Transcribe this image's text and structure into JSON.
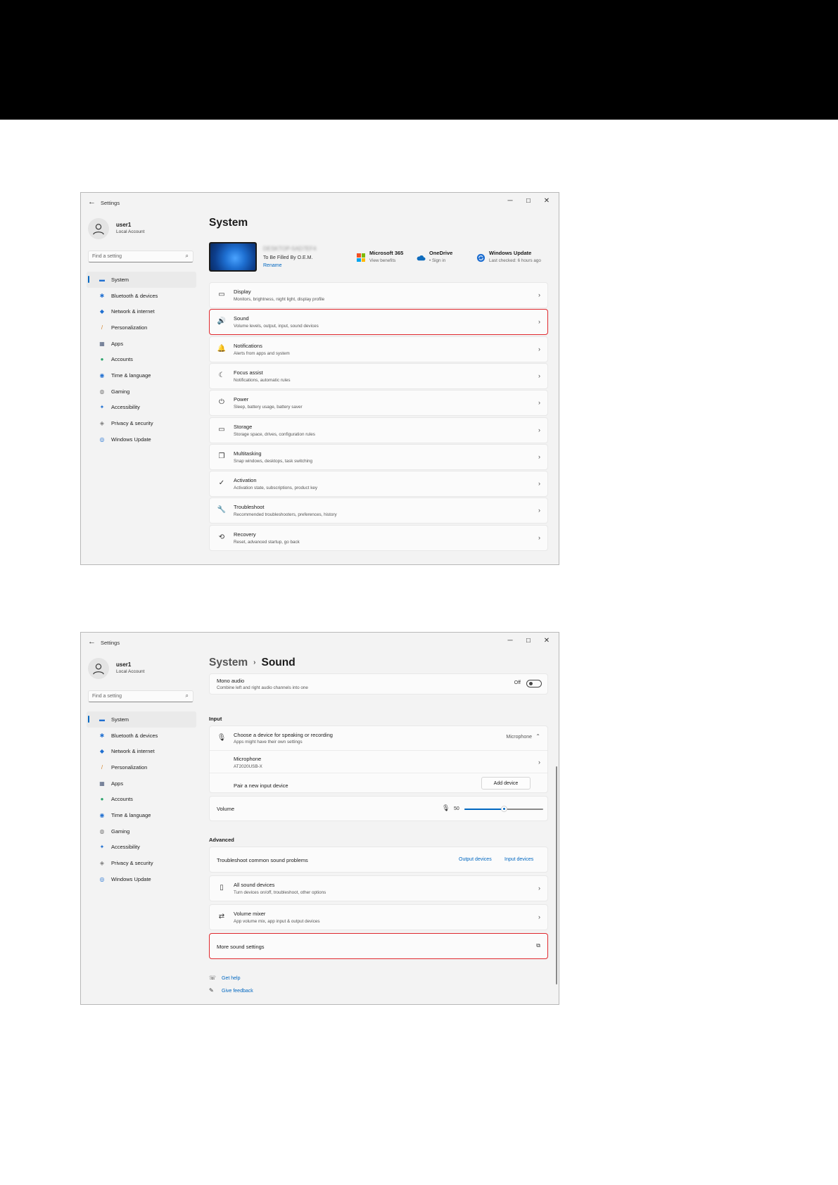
{
  "common": {
    "app_title": "Settings",
    "back_glyph": "←",
    "user_name": "user1",
    "user_type": "Local Account",
    "search_placeholder": "Find a setting",
    "nav": [
      {
        "label": "System",
        "icon": "system-icon",
        "glyph": "▬",
        "color": "#1f6fd1"
      },
      {
        "label": "Bluetooth & devices",
        "icon": "bluetooth-icon",
        "glyph": "✱",
        "color": "#1f6fd1"
      },
      {
        "label": "Network & internet",
        "icon": "network-icon",
        "glyph": "◆",
        "color": "#1f6fd1"
      },
      {
        "label": "Personalization",
        "icon": "brush-icon",
        "glyph": "/",
        "color": "#d4842a"
      },
      {
        "label": "Apps",
        "icon": "apps-icon",
        "glyph": "▦",
        "color": "#4a5a7a"
      },
      {
        "label": "Accounts",
        "icon": "accounts-icon",
        "glyph": "●",
        "color": "#2aa36b"
      },
      {
        "label": "Time & language",
        "icon": "globe-clock-icon",
        "glyph": "◉",
        "color": "#1f6fd1"
      },
      {
        "label": "Gaming",
        "icon": "gamepad-icon",
        "glyph": "◍",
        "color": "#7a7a7a"
      },
      {
        "label": "Accessibility",
        "icon": "accessibility-icon",
        "glyph": "✦",
        "color": "#1f6fd1"
      },
      {
        "label": "Privacy & security",
        "icon": "shield-icon",
        "glyph": "◈",
        "color": "#7a7a7a"
      },
      {
        "label": "Windows Update",
        "icon": "update-icon",
        "glyph": "◎",
        "color": "#1f6fd1"
      }
    ]
  },
  "screen1": {
    "page_title": "System",
    "pc_name": "DESKTOP-5AD7EF4",
    "pc_desc": "To Be Filled By O.E.M.",
    "pc_rename": "Rename",
    "tiles": [
      {
        "title": "Microsoft 365",
        "sub": "View benefits"
      },
      {
        "title": "OneDrive",
        "sub": "• Sign in"
      },
      {
        "title": "Windows Update",
        "sub": "Last checked: 6 hours ago"
      }
    ],
    "cards": [
      {
        "title": "Display",
        "sub": "Monitors, brightness, night light, display profile",
        "icon": "display-icon",
        "glyph": "▭"
      },
      {
        "title": "Sound",
        "sub": "Volume levels, output, input, sound devices",
        "icon": "speaker-icon",
        "glyph": "🔊"
      },
      {
        "title": "Notifications",
        "sub": "Alerts from apps and system",
        "icon": "bell-icon",
        "glyph": "🔔"
      },
      {
        "title": "Focus assist",
        "sub": "Notifications, automatic rules",
        "icon": "moon-icon",
        "glyph": "☾"
      },
      {
        "title": "Power",
        "sub": "Sleep, battery usage, battery saver",
        "icon": "power-icon",
        "glyph": "⏻"
      },
      {
        "title": "Storage",
        "sub": "Storage space, drives, configuration rules",
        "icon": "storage-icon",
        "glyph": "▭"
      },
      {
        "title": "Multitasking",
        "sub": "Snap windows, desktops, task switching",
        "icon": "multitasking-icon",
        "glyph": "❐"
      },
      {
        "title": "Activation",
        "sub": "Activation state, subscriptions, product key",
        "icon": "check-circle-icon",
        "glyph": "✓"
      },
      {
        "title": "Troubleshoot",
        "sub": "Recommended troubleshooters, preferences, history",
        "icon": "wrench-icon",
        "glyph": "🔧"
      },
      {
        "title": "Recovery",
        "sub": "Reset, advanced startup, go back",
        "icon": "recovery-icon",
        "glyph": "⟲"
      }
    ]
  },
  "screen2": {
    "crumb_parent": "System",
    "crumb_sep": "›",
    "crumb_current": "Sound",
    "mono_title": "Mono audio",
    "mono_sub": "Combine left and right audio channels into one",
    "mono_state": "Off",
    "input_header": "Input",
    "choose_title": "Choose a device for speaking or recording",
    "choose_sub": "Apps might have their own settings",
    "choose_value": "Microphone",
    "mic_title": "Microphone",
    "mic_sub": "AT2020USB-X",
    "pair_label": "Pair a new input device",
    "add_device": "Add device",
    "volume_label": "Volume",
    "volume_value": "50",
    "volume_level": 0.5,
    "advanced_header": "Advanced",
    "troubleshoot_label": "Troubleshoot common sound problems",
    "output_devices": "Output devices",
    "input_devices": "Input devices",
    "all_devices_title": "All sound devices",
    "all_devices_sub": "Turn devices on/off, troubleshoot, other options",
    "mixer_title": "Volume mixer",
    "mixer_sub": "App volume mix, app input & output devices",
    "more_sound": "More sound settings",
    "get_help": "Get help",
    "give_feedback": "Give feedback"
  }
}
